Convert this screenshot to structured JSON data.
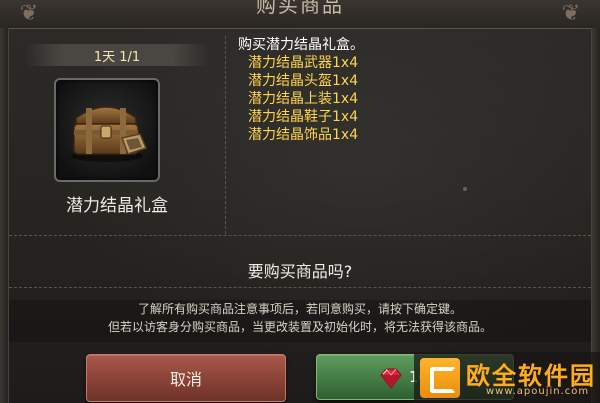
{
  "dialog": {
    "title": "购买商品",
    "purchase_limit": "1天 1/1",
    "item_name": "潜力结晶礼盒",
    "description_title": "购买潜力结晶礼盒。",
    "contents": [
      "潜力结晶武器1x4",
      "潜力结晶头盔1x4",
      "潜力结晶上装1x4",
      "潜力结晶鞋子1x4",
      "潜力结晶饰品1x4"
    ],
    "question": "要购买商品吗?",
    "notice_line1": "了解所有购买商品注意事项后，若同意购买，请按下确定键。",
    "notice_line2": "但若以访客身分购买商品，当更改装置及初始化时，将无法获得该商品。"
  },
  "buttons": {
    "cancel_label": "取消",
    "confirm_price": "10"
  },
  "watermark": {
    "brand": "欧全软件园",
    "url": "www.apoujin.com"
  },
  "icons": {
    "item": "treasure-chest-icon",
    "currency": "ruby-gem-icon"
  },
  "colors": {
    "highlight_text": "#ffd54a",
    "cancel_button": "#8c4438",
    "confirm_button": "#467f46"
  }
}
